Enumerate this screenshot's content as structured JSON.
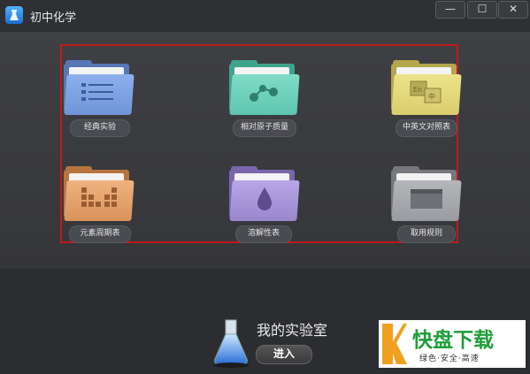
{
  "app": {
    "title": "初中化学",
    "icon": "flask-app-icon"
  },
  "window_controls": {
    "minimize": "—",
    "maximize": "☐",
    "close": "✕"
  },
  "folders": [
    {
      "label": "经典实验",
      "icon": "list-icon",
      "color": "#6f95d8"
    },
    {
      "label": "相对原子质量",
      "icon": "molecule-icon",
      "color": "#5ec6b0"
    },
    {
      "label": "中英文对照表",
      "icon": "translate-icon",
      "color": "#d9cd6e"
    },
    {
      "label": "元素周期表",
      "icon": "grid-icon",
      "color": "#d9935b"
    },
    {
      "label": "溶解性表",
      "icon": "droplet-icon",
      "color": "#9a86cc"
    },
    {
      "label": "取用规则",
      "icon": "window-icon",
      "color": "#9a9ba0"
    }
  ],
  "lab": {
    "title": "我的实验室",
    "enter_label": "进入"
  },
  "watermark": {
    "brand": "快盘下载",
    "slogan": "绿色·安全·高速"
  }
}
